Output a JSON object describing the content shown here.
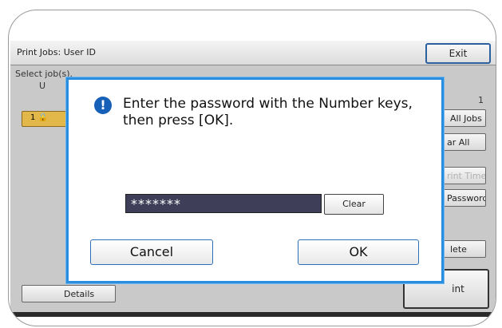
{
  "header": {
    "title": "Print Jobs: User ID",
    "exit_label": "Exit"
  },
  "background": {
    "select_label": "Select job(s).",
    "user_col_label": "U",
    "count": "1",
    "user_tag_text": "1 🔒",
    "buttons": {
      "all_jobs": "All Jobs",
      "clear_all": "ar All",
      "print_time": "rint Time",
      "password": "Password",
      "delete": "lete",
      "details": "Details",
      "print": "int"
    }
  },
  "dialog": {
    "message": "Enter the password with the Number keys, then press [OK].",
    "password_value": "*******",
    "clear_label": "Clear",
    "cancel_label": "Cancel",
    "ok_label": "OK"
  },
  "colors": {
    "dialog_border": "#2a8ee0",
    "info_icon": "#1660b8",
    "password_field": "#3e3e58"
  }
}
